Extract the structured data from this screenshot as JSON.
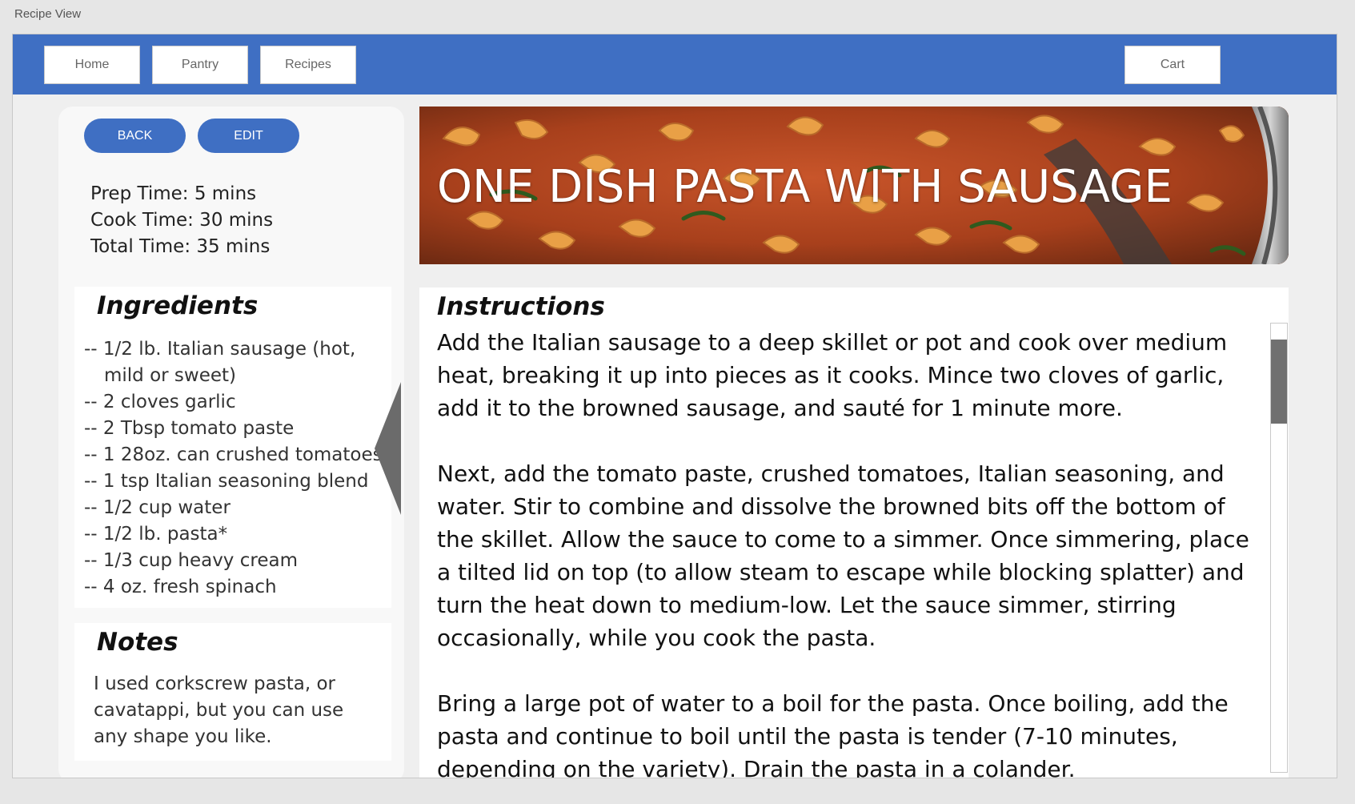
{
  "window": {
    "title": "Recipe View"
  },
  "nav": {
    "home": "Home",
    "pantry": "Pantry",
    "recipes": "Recipes",
    "cart": "Cart",
    "color": "#3f6fc3"
  },
  "actions": {
    "back": "BACK",
    "edit": "EDIT"
  },
  "times": {
    "prep": "Prep Time: 5 mins",
    "cook": "Cook Time: 30 mins",
    "total": "Total Time: 35 mins"
  },
  "ingredients": {
    "title": "Ingredients",
    "items": [
      "-- 1/2 lb. Italian sausage (hot, mild or sweet)",
      "-- 2 cloves garlic",
      "-- 2 Tbsp tomato paste",
      "-- 1 28oz. can crushed tomatoes",
      "-- 1 tsp Italian seasoning blend",
      "-- 1/2 cup water",
      "-- 1/2 lb. pasta*",
      "-- 1/3 cup heavy cream",
      "-- 4 oz. fresh spinach"
    ]
  },
  "notes": {
    "title": "Notes",
    "text": "I used corkscrew pasta, or cavatappi, but you can use any shape you like."
  },
  "recipe": {
    "title": "ONE DISH PASTA WITH SAUSAGE",
    "image_icon": "pasta-photo"
  },
  "instructions": {
    "title": "Instructions",
    "paragraphs": [
      "Add the Italian sausage to a deep skillet or pot and cook over medium heat, breaking it up into pieces as it cooks. Mince two cloves of garlic, add it to the browned sausage, and sauté for 1 minute more.",
      "Next, add the tomato paste, crushed tomatoes, Italian seasoning, and water. Stir to combine and dissolve the browned bits off the bottom of the skillet. Allow the sauce to come to a simmer. Once simmering, place a tilted lid on top (to allow steam to escape while blocking splatter) and turn the heat down to medium-low. Let the sauce simmer, stirring occasionally, while you cook the pasta.",
      "Bring a large pot of water to a boil for the pasta. Once boiling, add the pasta and continue to boil until the pasta is tender (7-10 minutes, depending on the variety). Drain the pasta in a colander."
    ]
  }
}
